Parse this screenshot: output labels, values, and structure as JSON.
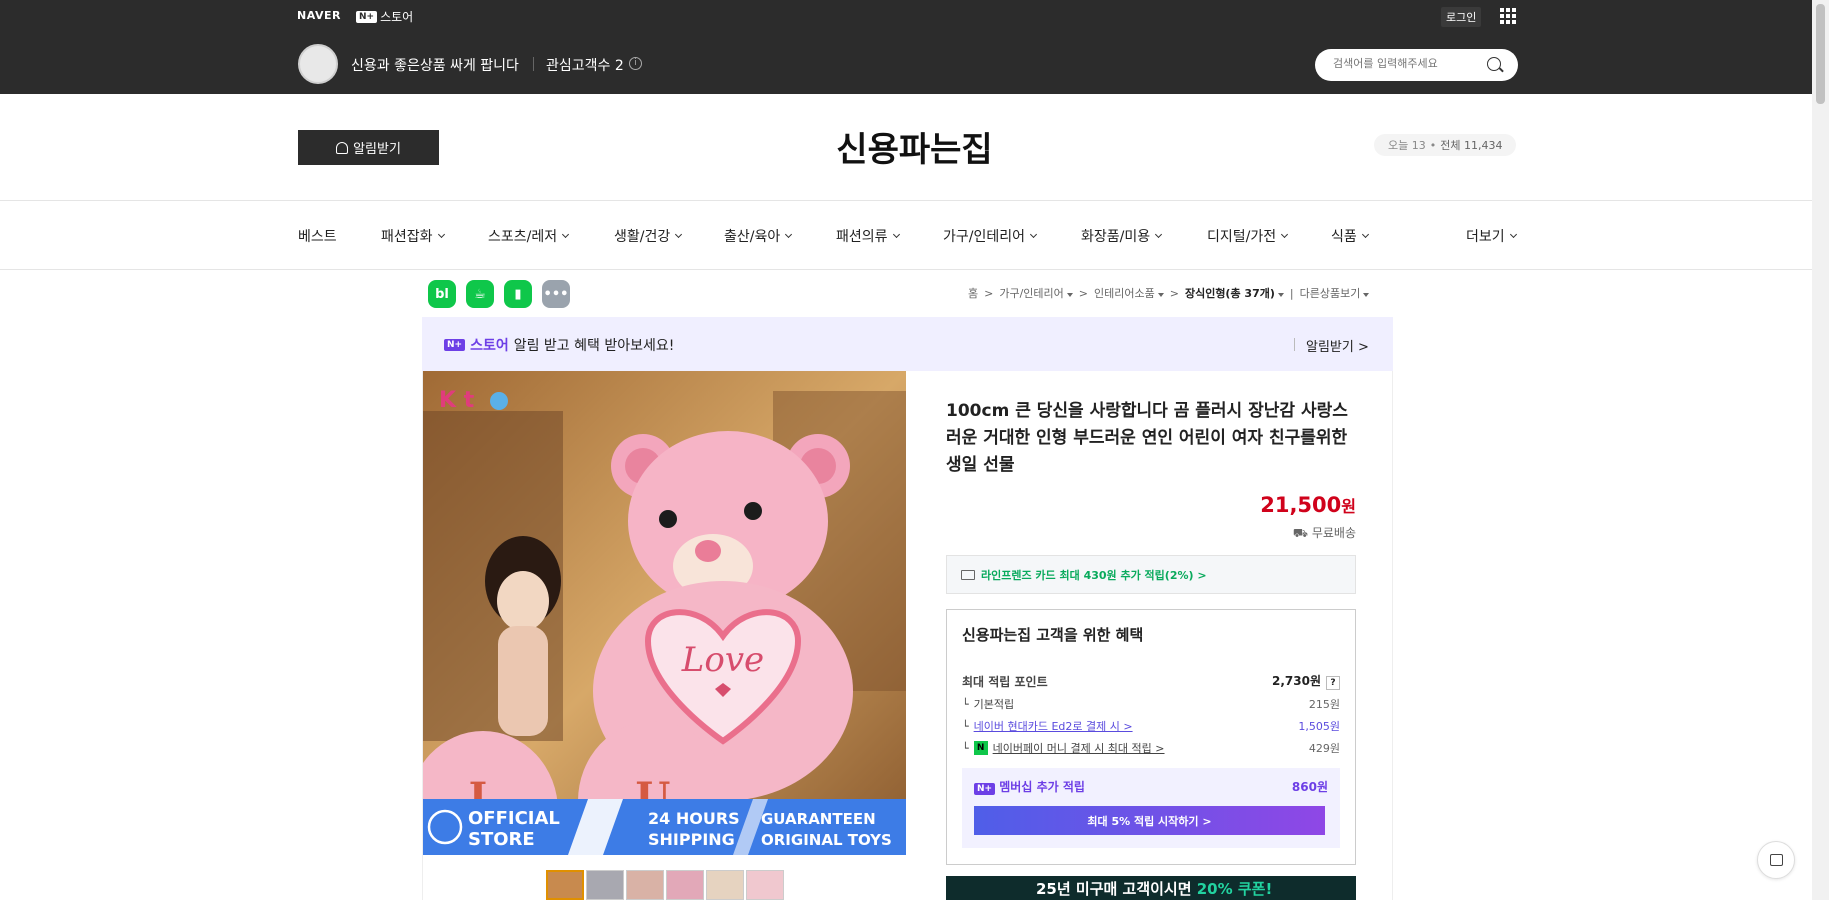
{
  "topbar": {
    "brand": "NAVER",
    "nstore_badge": "N+",
    "nstore_label": "스토어",
    "login": "로그인",
    "shop_desc": "신용과 좋은상품 싸게 팝니다",
    "followers": "관심고객수 2",
    "search_placeholder": "검색어를 입력해주세요"
  },
  "header": {
    "alarm_button": "알림받기",
    "shop_name": "신용파는집",
    "visitor_today": "오늘 13",
    "visitor_dot": "•",
    "visitor_total": "전체 11,434"
  },
  "nav": {
    "items": [
      "베스트",
      "패션잡화",
      "스포츠/레저",
      "생활/건강",
      "출산/육아",
      "패션의류",
      "가구/인테리어",
      "화장품/미용",
      "디지털/가전",
      "식품"
    ],
    "more": "더보기"
  },
  "share_icons": [
    "bl",
    "cafe-icon",
    "bookmark-icon",
    "more-icon"
  ],
  "breadcrumb": {
    "home": "홈",
    "c1": "가구/인테리어",
    "c2": "인테리어소품",
    "c3": "장식인형(총 37개)",
    "other": "다른상품보기"
  },
  "promo": {
    "badge": "N+",
    "store": "스토어",
    "text": "알림 받고 혜택 받아보세요!",
    "link": "알림받기 >"
  },
  "image": {
    "banner_line1": "OFFICIAL",
    "banner_line2": "STORE",
    "banner_mid1": "24 HOURS",
    "banner_mid2": "SHIPPING",
    "banner_right1": "GUARANTEEN",
    "banner_right2": "ORIGINAL TOYS",
    "heart_text": "Love",
    "logo_text": "K t"
  },
  "product": {
    "title": "100cm 큰 당신을 사랑합니다 곰 플러시 장난감 사랑스러운 거대한 인형 부드러운 연인 어린이 여자 친구를위한 생일 선물",
    "price": "21,500",
    "price_unit": "원",
    "shipping": "무료배송",
    "card_promo": "라인프렌즈 카드 최대 430원 추가 적립(2%) >"
  },
  "benefit": {
    "title": "신용파는집 고객을 위한 혜택",
    "max_label": "최대 적립 포인트",
    "max_value": "2,730원",
    "basic_label": "기본적립",
    "basic_value": "215원",
    "card_label": "네이버 현대카드 Ed2로 결제 시 >",
    "card_value": "1,505원",
    "pay_label": "네이버페이 머니 결제 시 최대 적립 >",
    "pay_value": "429원",
    "member_label": "멤버십 추가 적립",
    "member_value": "860원",
    "member_button": "최대 5% 적립 시작하기 >",
    "qmark": "?",
    "npay": "N"
  },
  "banner": {
    "text_a": "25년 미구매 고객이시면 ",
    "text_b": "20% 쿠폰!"
  }
}
